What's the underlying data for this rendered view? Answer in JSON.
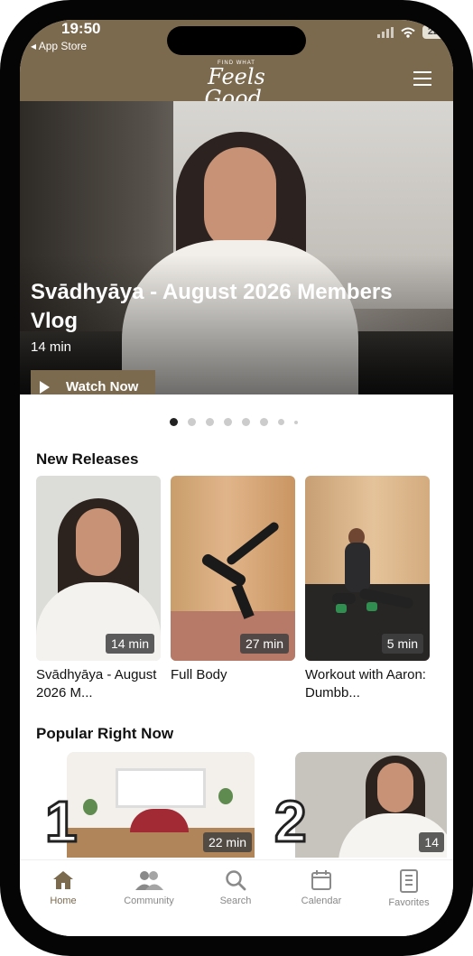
{
  "status_bar": {
    "time": "19:50",
    "back_app": "◂ App Store",
    "battery": "22"
  },
  "header": {
    "brand_small": "FIND WHAT",
    "brand_large": "Feels Good.",
    "menu_icon": "hamburger-menu-icon"
  },
  "hero": {
    "title": "Svādhyāya - August 2026 Members Vlog",
    "duration": "14 min",
    "watch_label": "Watch Now",
    "carousel_total": 8,
    "carousel_active": 1
  },
  "new_releases": {
    "title": "New Releases",
    "items": [
      {
        "title": "Svādhyāya - August 2026 M...",
        "duration": "14 min"
      },
      {
        "title": "Full Body",
        "duration": "27 min"
      },
      {
        "title": "Workout with Aaron: Dumbb...",
        "duration": "5 min"
      }
    ]
  },
  "popular": {
    "title": "Popular Right Now",
    "items": [
      {
        "rank": "1",
        "duration": "22 min"
      },
      {
        "rank": "2",
        "duration": "14"
      }
    ]
  },
  "tabbar": {
    "items": [
      {
        "label": "Home",
        "icon": "home-icon",
        "active": true
      },
      {
        "label": "Community",
        "icon": "community-icon",
        "active": false
      },
      {
        "label": "Search",
        "icon": "search-icon",
        "active": false
      },
      {
        "label": "Calendar",
        "icon": "calendar-icon",
        "active": false
      },
      {
        "label": "Favorites",
        "icon": "favorites-icon",
        "active": false
      }
    ]
  },
  "colors": {
    "brand": "#7b6a4e",
    "active_tab": "#7b6a4e",
    "inactive_tab": "#888888"
  }
}
